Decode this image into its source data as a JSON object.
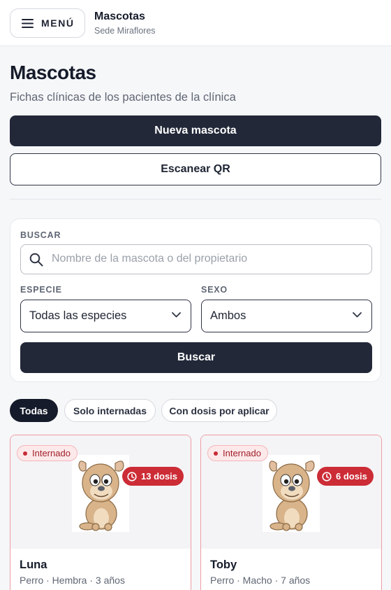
{
  "header": {
    "menu_label": "MENÚ",
    "title": "Mascotas",
    "subtitle": "Sede Miraflores"
  },
  "page": {
    "title": "Mascotas",
    "subtitle": "Fichas clínicas de los pacientes de la clínica"
  },
  "actions": {
    "new_label": "Nueva mascota",
    "scan_label": "Escanear QR"
  },
  "search": {
    "label": "BUSCAR",
    "placeholder": "Nombre de la mascota o del propietario",
    "value": "",
    "species_label": "ESPECIE",
    "species_value": "Todas las especies",
    "sex_label": "SEXO",
    "sex_value": "Ambos",
    "button_label": "Buscar"
  },
  "filters": [
    {
      "label": "Todas",
      "active": true
    },
    {
      "label": "Solo internadas",
      "active": false
    },
    {
      "label": "Con dosis por aplicar",
      "active": false
    }
  ],
  "pets": [
    {
      "status": "Internado",
      "doses": "13 dosis",
      "name": "Luna",
      "meta": "Perro · Hembra · 3 años",
      "icon": "dog-cartoon"
    },
    {
      "status": "Internado",
      "doses": "6 dosis",
      "name": "Toby",
      "meta": "Perro · Macho · 7 años",
      "icon": "dog-cartoon"
    }
  ],
  "colors": {
    "primary": "#222838",
    "alert": "#cc2c36",
    "card_border": "#ee9ca4"
  }
}
